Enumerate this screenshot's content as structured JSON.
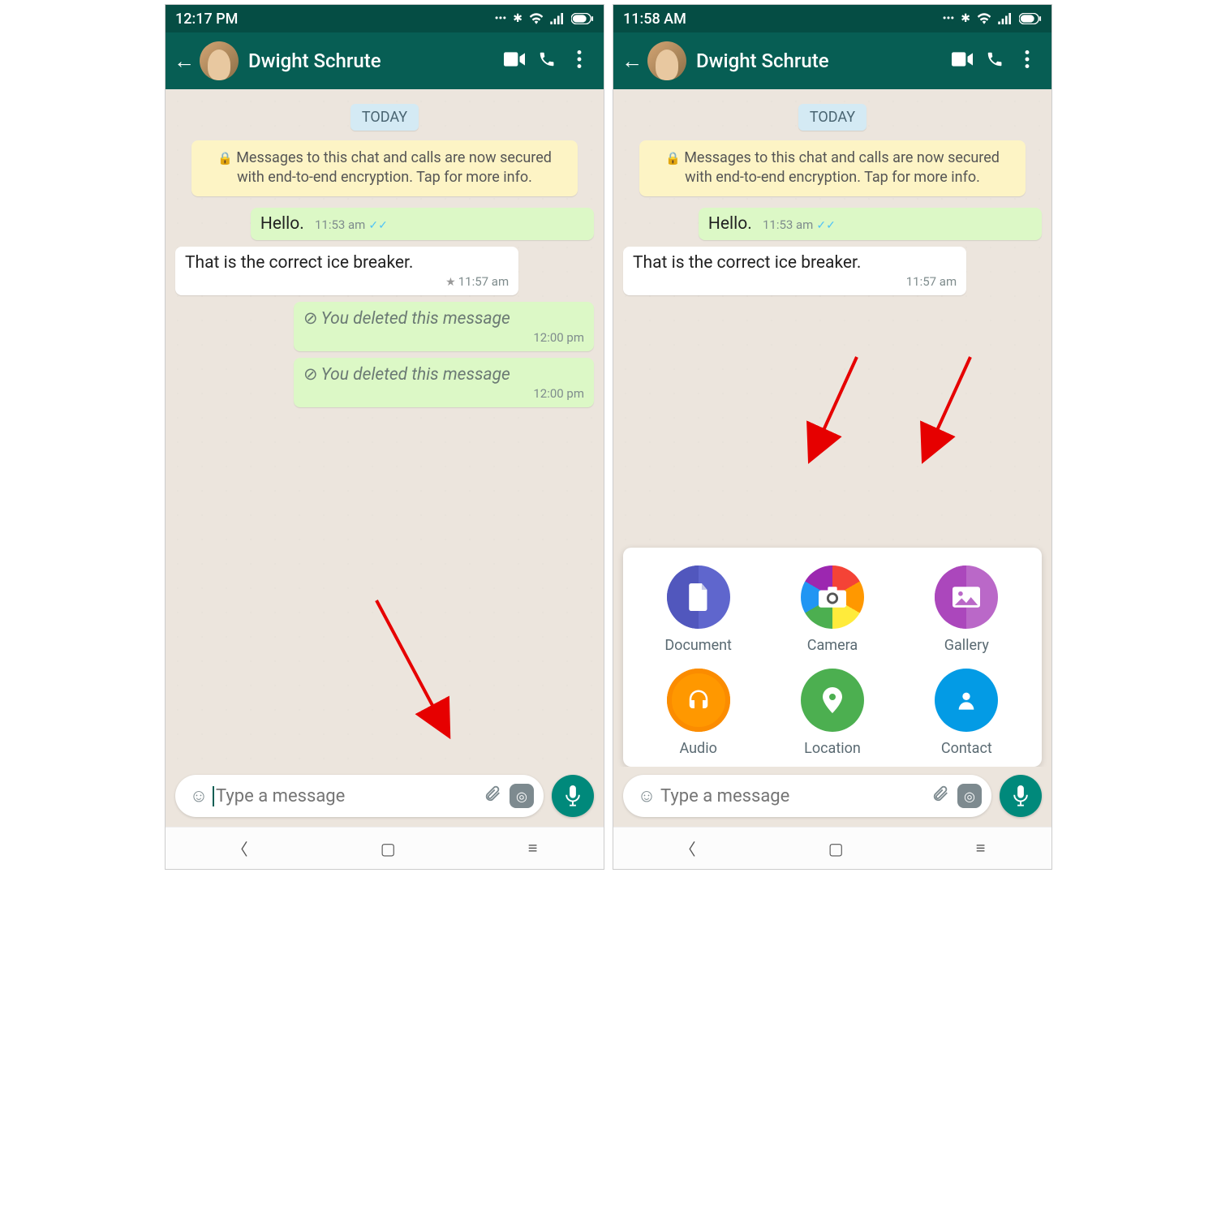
{
  "left": {
    "status_time": "12:17 PM",
    "chat_name": "Dwight Schrute",
    "date_badge": "TODAY",
    "encryption_notice": "Messages to this chat and calls are now secured with end-to-end encryption. Tap for more info.",
    "messages": [
      {
        "dir": "out",
        "text": "Hello.",
        "time": "11:53 am",
        "ticks": true
      },
      {
        "dir": "in",
        "text": "That is the correct ice breaker.",
        "time": "11:57 am",
        "starred": true
      },
      {
        "dir": "deleted",
        "text": "You deleted this message",
        "time": "12:00 pm"
      },
      {
        "dir": "deleted",
        "text": "You deleted this message",
        "time": "12:00 pm"
      }
    ],
    "input_placeholder": "Type a message"
  },
  "right": {
    "status_time": "11:58 AM",
    "chat_name": "Dwight Schrute",
    "date_badge": "TODAY",
    "encryption_notice": "Messages to this chat and calls are now secured with end-to-end encryption. Tap for more info.",
    "messages": [
      {
        "dir": "out",
        "text": "Hello.",
        "time": "11:53 am",
        "ticks": true
      },
      {
        "dir": "in",
        "text": "That is the correct ice breaker.",
        "time": "11:57 am"
      }
    ],
    "input_placeholder": "Type a message",
    "attach_options": [
      {
        "label": "Document",
        "icon": "doc"
      },
      {
        "label": "Camera",
        "icon": "cam"
      },
      {
        "label": "Gallery",
        "icon": "gal"
      },
      {
        "label": "Audio",
        "icon": "aud"
      },
      {
        "label": "Location",
        "icon": "loc"
      },
      {
        "label": "Contact",
        "icon": "con"
      }
    ]
  }
}
